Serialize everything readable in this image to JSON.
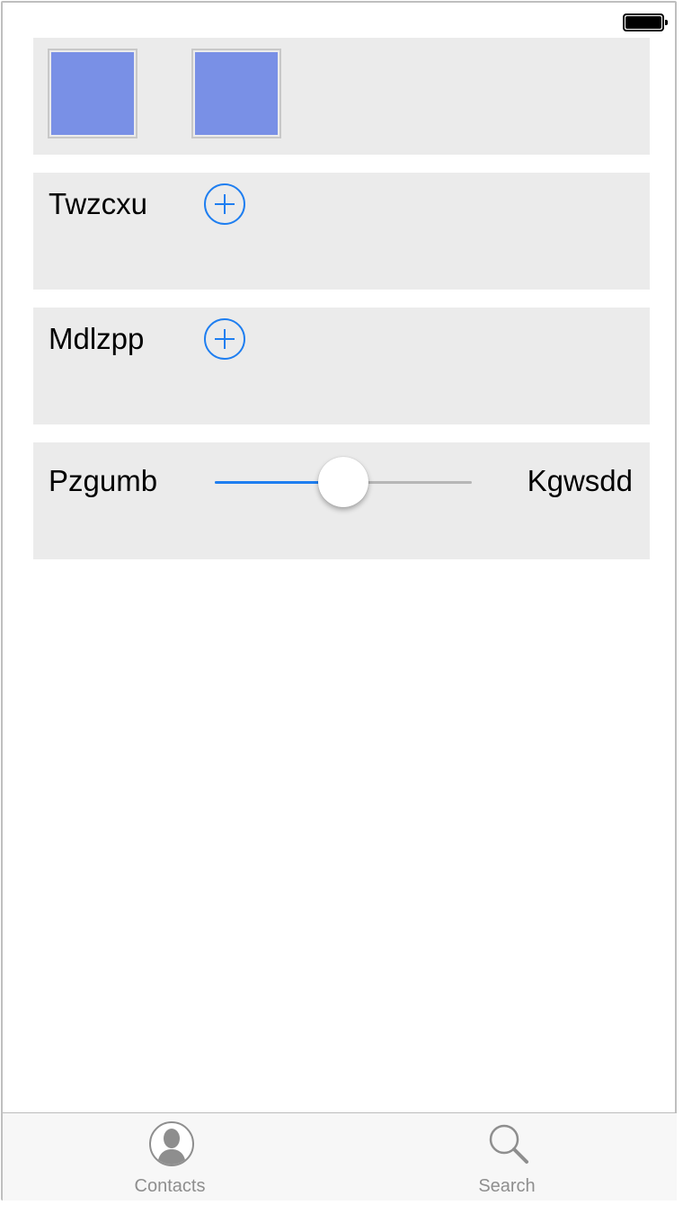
{
  "status_bar": {
    "battery_icon": "battery-full-icon"
  },
  "thumbnails": {
    "color": "#7990e6"
  },
  "rows": [
    {
      "label": "Twzcxu",
      "action_icon": "add-circle-icon"
    },
    {
      "label": "Mdlzpp",
      "action_icon": "add-circle-icon"
    }
  ],
  "slider_row": {
    "min_label": "Pzgumb",
    "max_label": "Kgwsdd",
    "value_fraction": 0.5,
    "accent": "#1e7ef0"
  },
  "tabbar": {
    "tabs": [
      {
        "label": "Contacts",
        "icon": "contacts-icon"
      },
      {
        "label": "Search",
        "icon": "search-icon"
      }
    ]
  }
}
